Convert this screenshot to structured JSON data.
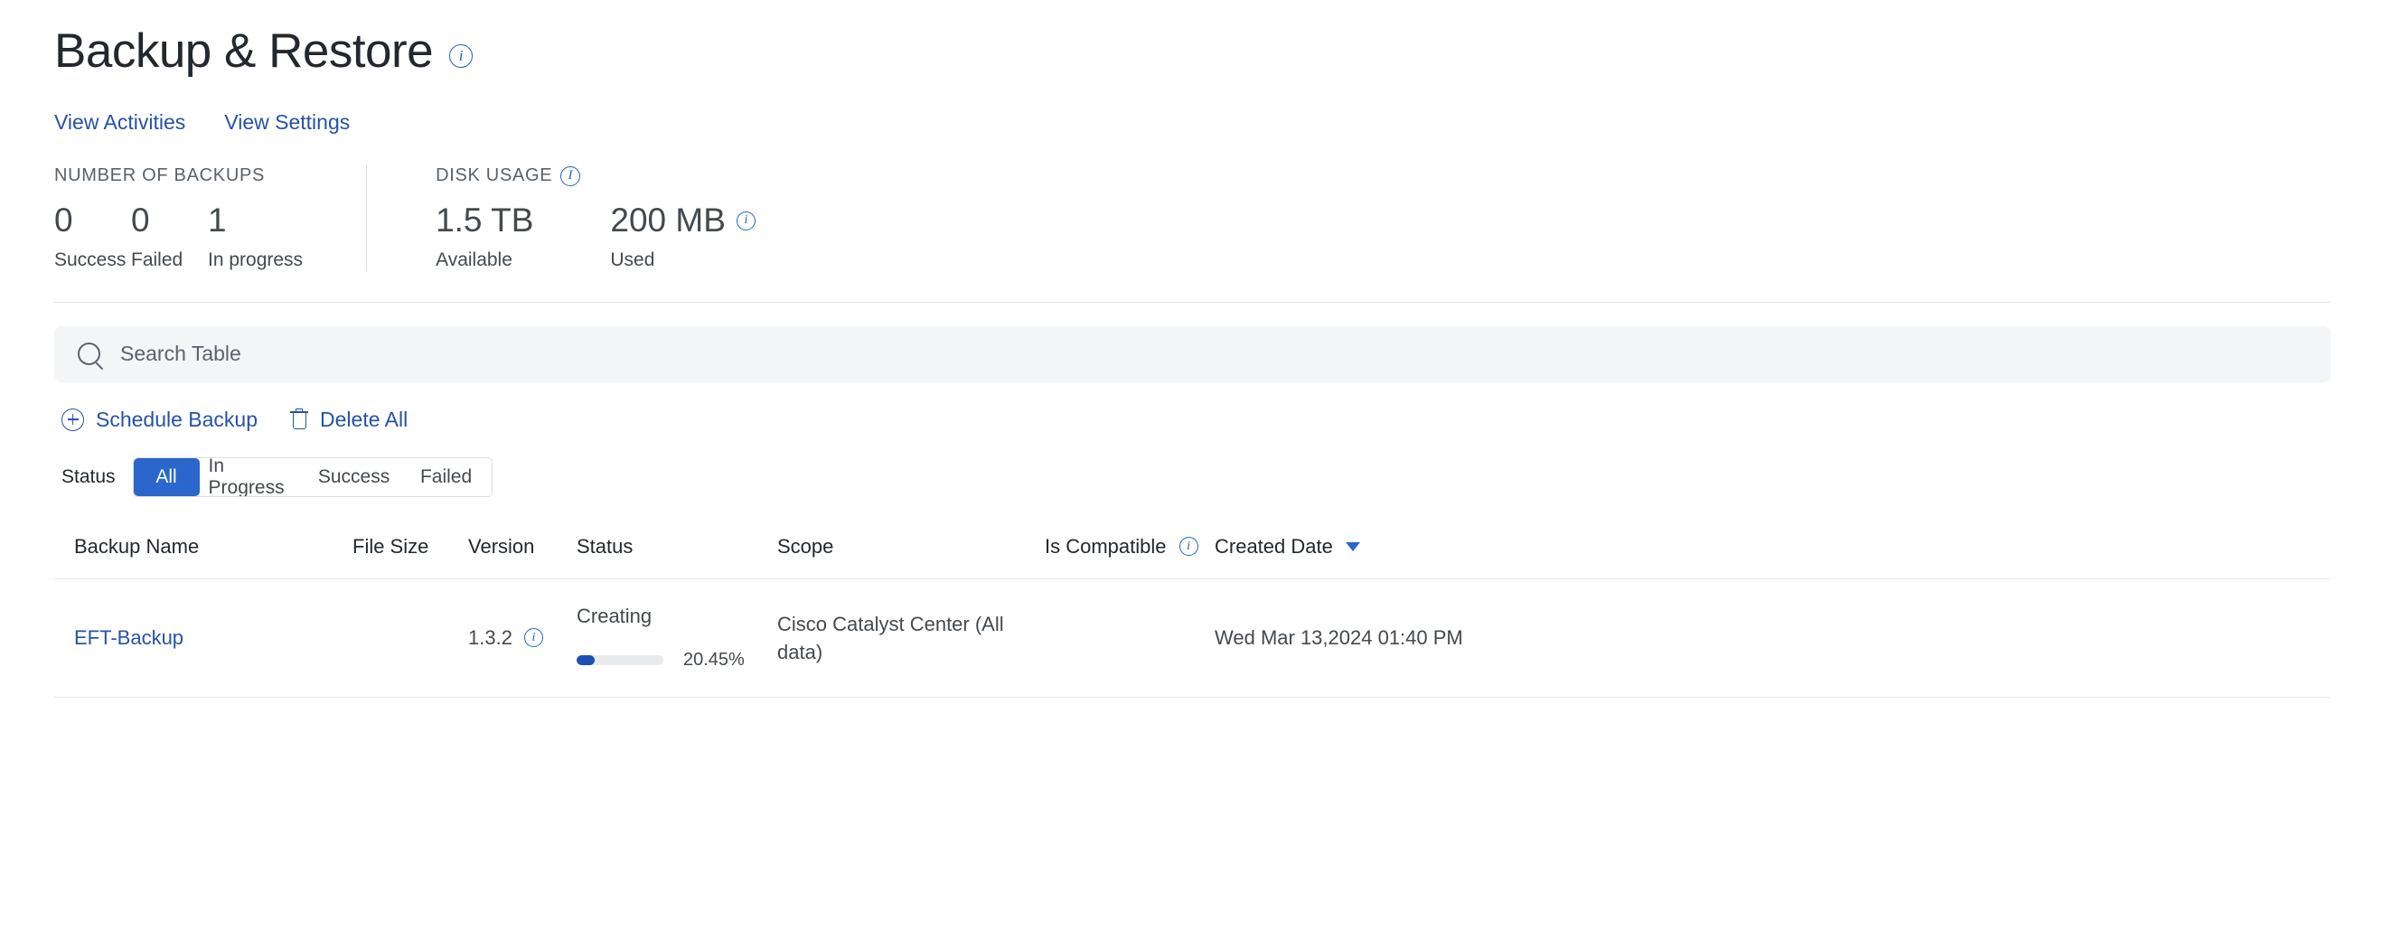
{
  "header": {
    "title": "Backup & Restore",
    "info_icon": "info-icon"
  },
  "quick_links": [
    {
      "label": "View Activities"
    },
    {
      "label": "View Settings"
    }
  ],
  "stats": {
    "backups": {
      "label": "NUMBER OF BACKUPS",
      "items": [
        {
          "value": "0",
          "caption": "Success"
        },
        {
          "value": "0",
          "caption": "Failed"
        },
        {
          "value": "1",
          "caption": "In progress"
        }
      ]
    },
    "disk": {
      "label": "DISK USAGE",
      "items": [
        {
          "value": "1.5 TB",
          "caption": "Available",
          "has_info": false
        },
        {
          "value": "200 MB",
          "caption": "Used",
          "has_info": true
        }
      ]
    }
  },
  "search": {
    "placeholder": "Search Table",
    "value": "",
    "icon": "search-icon"
  },
  "actions": [
    {
      "label": "Schedule Backup",
      "icon": "plus-circle-icon"
    },
    {
      "label": "Delete All",
      "icon": "trash-icon"
    }
  ],
  "status_filter": {
    "label": "Status",
    "options": [
      {
        "label": "All",
        "active": true
      },
      {
        "label": "In Progress",
        "active": false
      },
      {
        "label": "Success",
        "active": false
      },
      {
        "label": "Failed",
        "active": false
      }
    ]
  },
  "table": {
    "columns": [
      {
        "label": "Backup Name"
      },
      {
        "label": "File Size"
      },
      {
        "label": "Version"
      },
      {
        "label": "Status"
      },
      {
        "label": "Scope"
      },
      {
        "label": "Is Compatible"
      },
      {
        "label": "Created Date"
      }
    ],
    "sort": {
      "column": "Created Date",
      "direction": "desc"
    },
    "rows": [
      {
        "backup_name": "EFT-Backup",
        "file_size": "",
        "version": "1.3.2",
        "status": "Creating",
        "progress_pct": "20.45%",
        "progress_value": 20.45,
        "scope": "Cisco Catalyst Center (All data)",
        "is_compatible": "",
        "created_date": "Wed Mar 13,2024 01:40 PM"
      }
    ]
  },
  "colors": {
    "accent_blue": "#2553a5",
    "active_tab": "#2a66cc",
    "progress_fill": "#1f4fb3",
    "text_primary": "#23282e",
    "text_secondary": "#44494e",
    "search_bg": "#f4f5f7"
  }
}
